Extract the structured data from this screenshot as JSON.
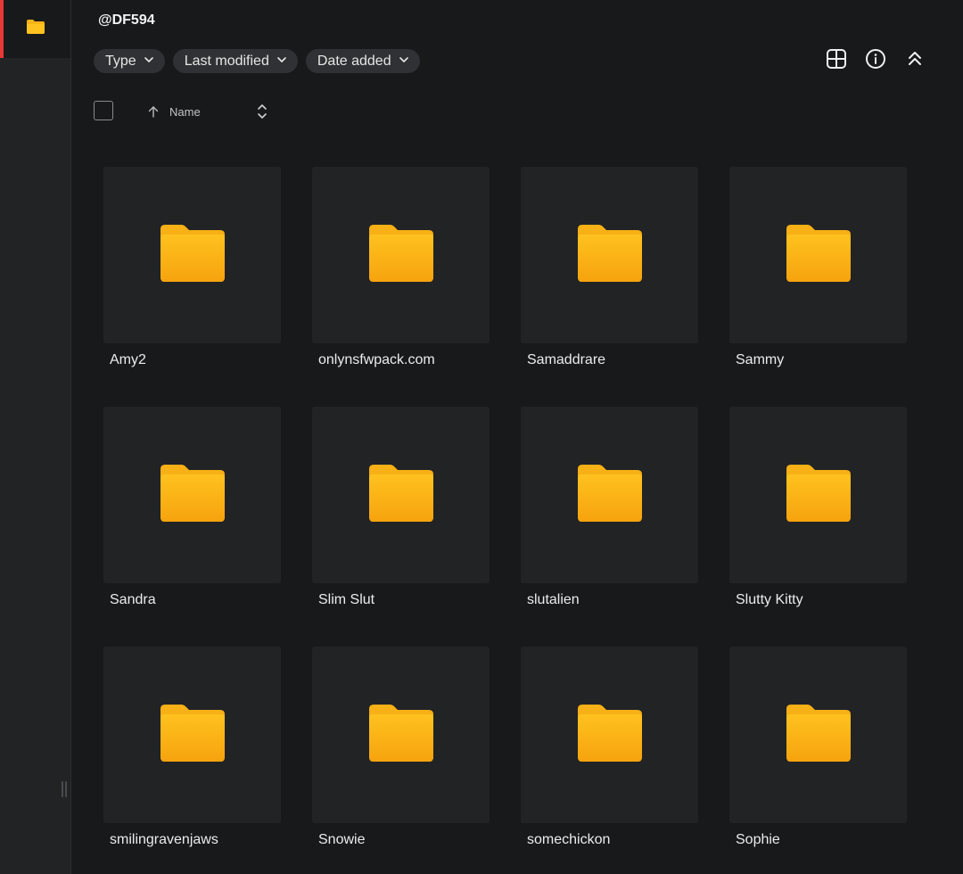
{
  "header": {
    "title": "@DF594"
  },
  "filters": [
    {
      "label": "Type"
    },
    {
      "label": "Last modified"
    },
    {
      "label": "Date added"
    }
  ],
  "toolbar": {
    "icons": [
      "grid-view-icon",
      "info-icon",
      "collapse-icon"
    ]
  },
  "sort": {
    "label": "Name",
    "direction": "ascending"
  },
  "folders": [
    {
      "name": "Amy2"
    },
    {
      "name": "onlynsfwpack.com"
    },
    {
      "name": "Samaddrare"
    },
    {
      "name": "Sammy"
    },
    {
      "name": "Sandra"
    },
    {
      "name": "Slim Slut"
    },
    {
      "name": "slutalien"
    },
    {
      "name": "Slutty Kitty"
    },
    {
      "name": "smilingravenjaws"
    },
    {
      "name": "Snowie"
    },
    {
      "name": "somechickon"
    },
    {
      "name": "Sophie"
    }
  ],
  "colors": {
    "background": "#18191b",
    "sidebar": "#222325",
    "card": "#222325",
    "chip": "#303134",
    "active_indicator": "#e53935",
    "folder_top": "#ffc21f",
    "folder_bottom": "#f5a20c"
  }
}
